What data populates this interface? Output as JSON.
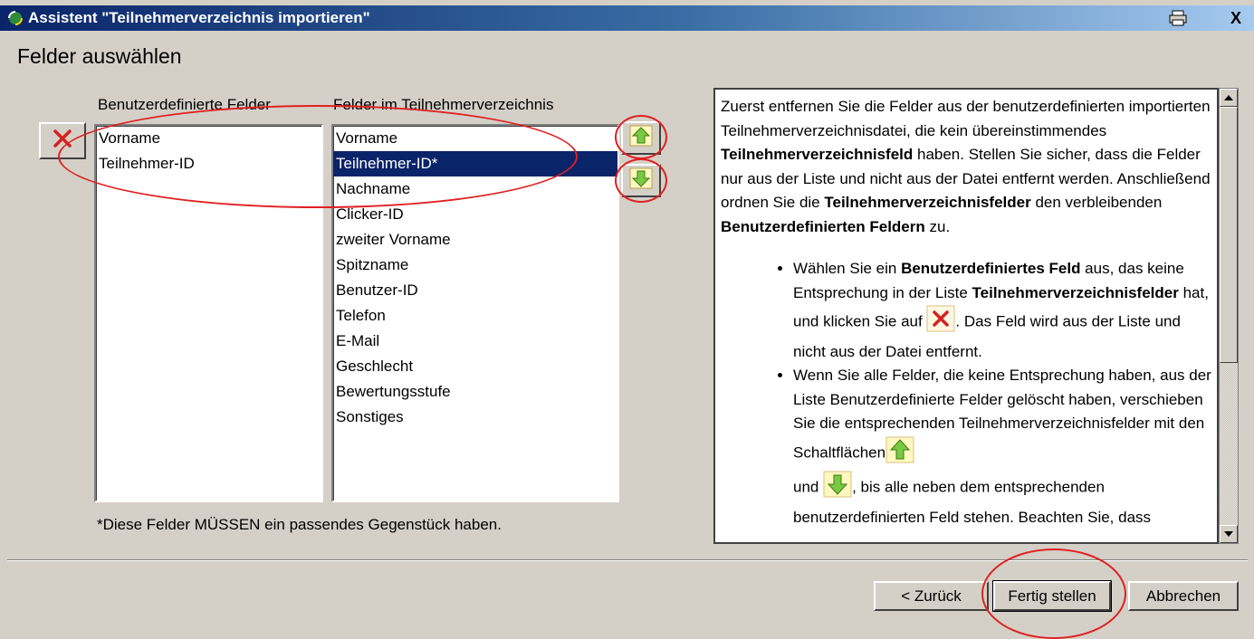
{
  "window": {
    "title": "Assistent \"Teilnehmerverzeichnis importieren\"",
    "close_glyph": "X"
  },
  "page": {
    "heading": "Felder auswählen"
  },
  "custom_fields": {
    "label": "Benutzerdefinierte Felder",
    "items": [
      "Vorname",
      "Teilnehmer-ID"
    ]
  },
  "directory_fields": {
    "label": "Felder im Teilnehmerverzeichnis",
    "items": [
      "Vorname",
      "Teilnehmer-ID*",
      "Nachname",
      "Clicker-ID",
      "zweiter Vorname",
      "Spitzname",
      "Benutzer-ID",
      "Telefon",
      "E-Mail",
      "Geschlecht",
      "Bewertungsstufe",
      "Sonstiges"
    ],
    "selected": "Teilnehmer-ID*"
  },
  "footnote": "*Diese Felder MÜSSEN ein passendes Gegenstück haben.",
  "help": {
    "p1_a": "Zuerst entfernen Sie die Felder aus der benutzerdefinierten importierten Teilnehmerverzeichnisdatei, die kein übereinstimmendes ",
    "p1_b": "Teilnehmerverzeichnisfeld",
    "p1_c": " haben. Stellen Sie sicher, dass die Felder nur aus der Liste und nicht aus der Datei entfernt werden. Anschließend ordnen Sie die ",
    "p1_d": "Teilnehmerverzeichnisfelder",
    "p1_e": " den verbleibenden ",
    "p1_f": "Benutzerdefinierten Feldern",
    "p1_g": " zu.",
    "b1_a": "Wählen Sie ein ",
    "b1_b": "Benutzerdefiniertes Feld",
    "b1_c": " aus, das keine Entsprechung in der Liste ",
    "b1_d": "Teilnehmerverzeichnisfelder",
    "b1_e": " hat, und klicken Sie auf ",
    "b1_f": ". Das Feld wird aus der Liste und nicht aus der Datei entfernt.",
    "b2_a": "Wenn Sie alle Felder, die keine Entsprechung haben, aus der Liste Benutzerdefinierte Felder gelöscht haben, verschieben Sie die entsprechenden Teilnehmerverzeichnisfelder mit den Schaltflächen",
    "b2_b": "und ",
    "b2_c": ", bis alle neben dem entsprechenden benutzerdefinierten Feld stehen. Beachten Sie, dass"
  },
  "buttons": {
    "back": "< Zurück",
    "finish": "Fertig stellen",
    "cancel": "Abbrechen"
  },
  "icons": {
    "delete": "red-x-icon",
    "up": "green-up-arrow-icon",
    "down": "green-down-arrow-icon",
    "annotation_color": "#e02020"
  }
}
